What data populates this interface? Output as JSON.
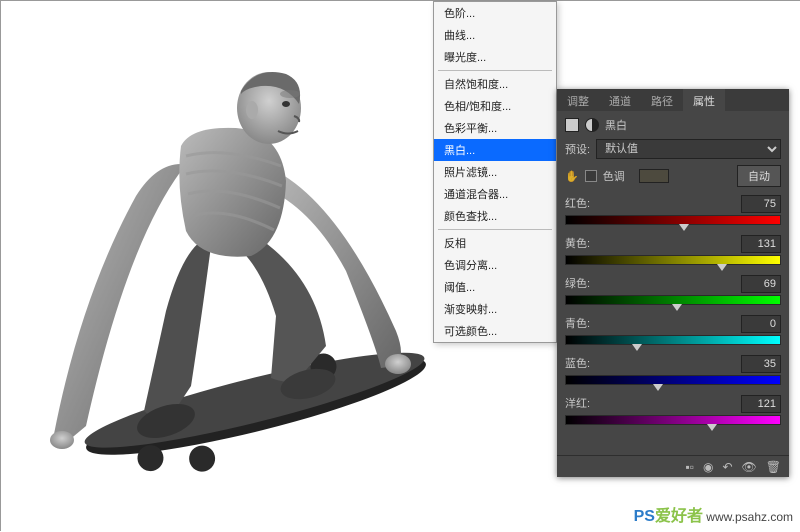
{
  "menu": {
    "items_top": [
      "色阶...",
      "曲线...",
      "曝光度..."
    ],
    "items_mid1": [
      "自然饱和度...",
      "色相/饱和度...",
      "色彩平衡..."
    ],
    "highlighted": "黑白...",
    "items_mid2": [
      "照片滤镜...",
      "通道混合器...",
      "颜色查找..."
    ],
    "items_bot": [
      "反相",
      "色调分离...",
      "阈值...",
      "渐变映射...",
      "可选颜色..."
    ]
  },
  "panel": {
    "tabs": {
      "adjust": "调整",
      "channel": "通道",
      "path": "路径",
      "properties": "属性"
    },
    "adj_name": "黑白",
    "preset_label": "预设:",
    "preset_value": "默认值",
    "tint_label": "色调",
    "auto_label": "自动",
    "sliders": {
      "red": {
        "label": "红色:",
        "value": 75,
        "pct": 55
      },
      "yellow": {
        "label": "黄色:",
        "value": 131,
        "pct": 73
      },
      "green": {
        "label": "绿色:",
        "value": 69,
        "pct": 52
      },
      "cyan": {
        "label": "青色:",
        "value": 0,
        "pct": 33
      },
      "blue": {
        "label": "蓝色:",
        "value": 35,
        "pct": 43
      },
      "magenta": {
        "label": "洋红:",
        "value": 121,
        "pct": 68
      }
    }
  },
  "watermark": {
    "site": "www.psahz.com",
    "logo1": "PS",
    "logo2": "爱好者"
  }
}
